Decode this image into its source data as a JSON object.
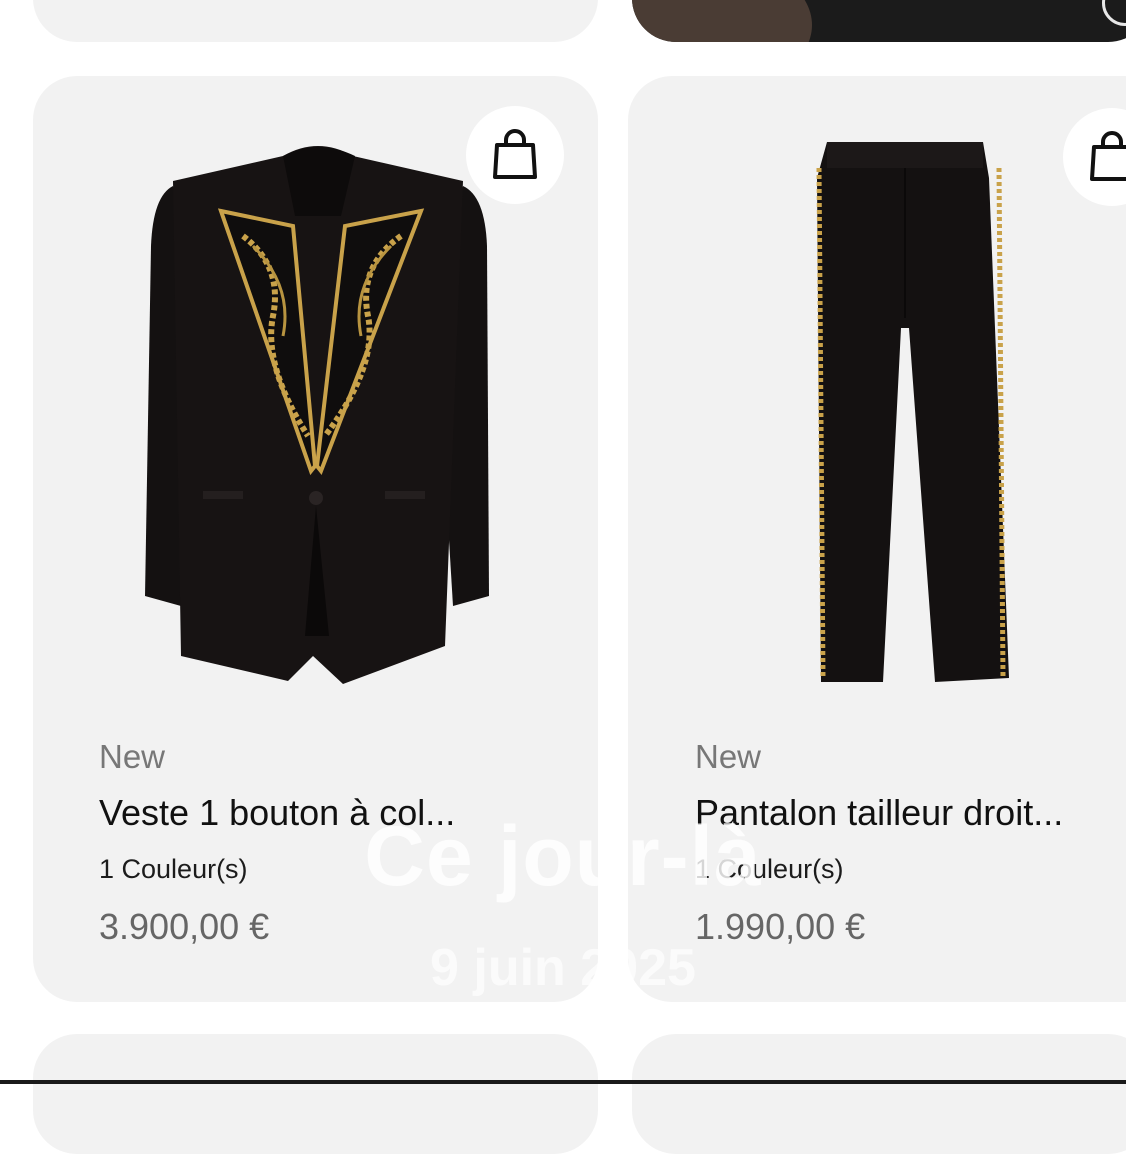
{
  "products": [
    {
      "tag": "New",
      "name": "Veste 1 bouton à col...",
      "colors": "1 Couleur(s)",
      "price": "3.900,00 €",
      "image": "black-jacket-gold-embroidered-lapels"
    },
    {
      "tag": "New",
      "name": "Pantalon tailleur droit...",
      "colors": "1 Couleur(s)",
      "price": "1.990,00 €",
      "image": "black-tailored-trousers-gold-side-trim"
    }
  ],
  "overlay": {
    "title": "Ce jour-là",
    "date": "9 juin 2025"
  },
  "icons": {
    "cart": "shopping-bag-icon"
  },
  "colors": {
    "card_bg": "#f2f2f2",
    "garment": "#141111",
    "embroidery": "#c9a24a",
    "muted_text": "#777777"
  }
}
